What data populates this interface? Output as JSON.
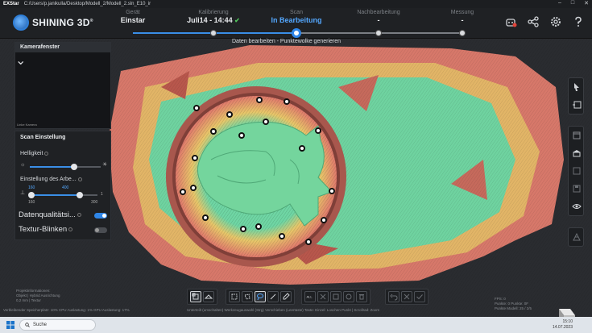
{
  "window": {
    "app_name": "EXStar",
    "path": "C:/Users/p.janikulla/Desktop/Modell_2/Modell_2.sln_E10_ir",
    "controls": [
      "–",
      "□",
      "✕"
    ]
  },
  "brand": {
    "logo_text": "SHINING 3D",
    "reg": "®"
  },
  "steps": [
    {
      "label": "Gerät",
      "value": "Einstar",
      "state": "done"
    },
    {
      "label": "Kalibrierung",
      "value": "Juli14 - 14:44",
      "state": "done",
      "check": "✔"
    },
    {
      "label": "Scan",
      "value": "In Bearbeitung",
      "state": "active"
    },
    {
      "label": "Nachbearbeitung",
      "value": "-",
      "state": "todo"
    },
    {
      "label": "Messung",
      "value": "-",
      "state": "todo"
    }
  ],
  "header_icons": [
    "robot-icon",
    "share-icon",
    "settings-icon",
    "help-icon"
  ],
  "viewport": {
    "status_message": "Daten bearbeiten - Punktewolke generieren"
  },
  "camera_window": {
    "title": "Kamerafenster",
    "caption": "Linke Kamera"
  },
  "scan_settings": {
    "title": "Scan Einstellung",
    "brightness_label": "Helligkeit",
    "brightness_level": 0.62,
    "working_distance_label": "Einstellung des Arbe...",
    "distance_low": "160",
    "distance_high": "400",
    "distance_min": "160",
    "distance_max": "300",
    "distance_end": "1",
    "data_quality_label": "Datenqualitätsi...",
    "data_quality_on": true,
    "texture_blink_label": "Textur-Blinken",
    "texture_blink_on": false
  },
  "project_info": {
    "title": "Projektinformationen:",
    "line1": "Objekt | Hybrid Ausrichtung",
    "line2": "0,2 mm | Textur"
  },
  "footer": {
    "left_text": "Verbleibender Speicherplatz: 10%  CPU Auslastung: 1%  GPU Auslastung: 17%",
    "center_text": "Unterteilt (umschalten) Werkzeugauswahl (Strg)  Verschieben (Leertaste)",
    "right_text": "Taste: Einzel: Loschen Punkt | Scrollrad: Zoom",
    "fps_line1": "FPS: 0",
    "fps_line2": "Punkte: 0 Punkte: 0F",
    "fps_line3": "Punkte Modell: 25 / 2/5"
  },
  "bottom_tools": [
    "view-mode-icon",
    "mesh-view-icon",
    "rect-select-icon",
    "polygon-select-icon",
    "lasso-select-icon",
    "line-select-icon",
    "brush-select-icon",
    "select-all-icon",
    "deselect-icon",
    "invert-select-icon",
    "connected-select-icon",
    "delete-icon",
    "undo-icon",
    "cancel-icon",
    "confirm-icon"
  ],
  "right_tools": [
    "pointer-tool-icon",
    "frame-tool-icon",
    "window-icon",
    "building-icon",
    "scan-target-icon",
    "save-icon",
    "eye-icon",
    "mesh-icon"
  ],
  "taskbar": {
    "search_placeholder": "Suche",
    "time": "15:10",
    "date": "14.07.2023"
  },
  "colors": {
    "accent": "#2f86e8",
    "active_step": "#54a8ff",
    "check": "#4fc35a",
    "scan_green": "#6fd6a4",
    "scan_red": "#e07a6c",
    "scan_yellow": "#e8c76a"
  }
}
